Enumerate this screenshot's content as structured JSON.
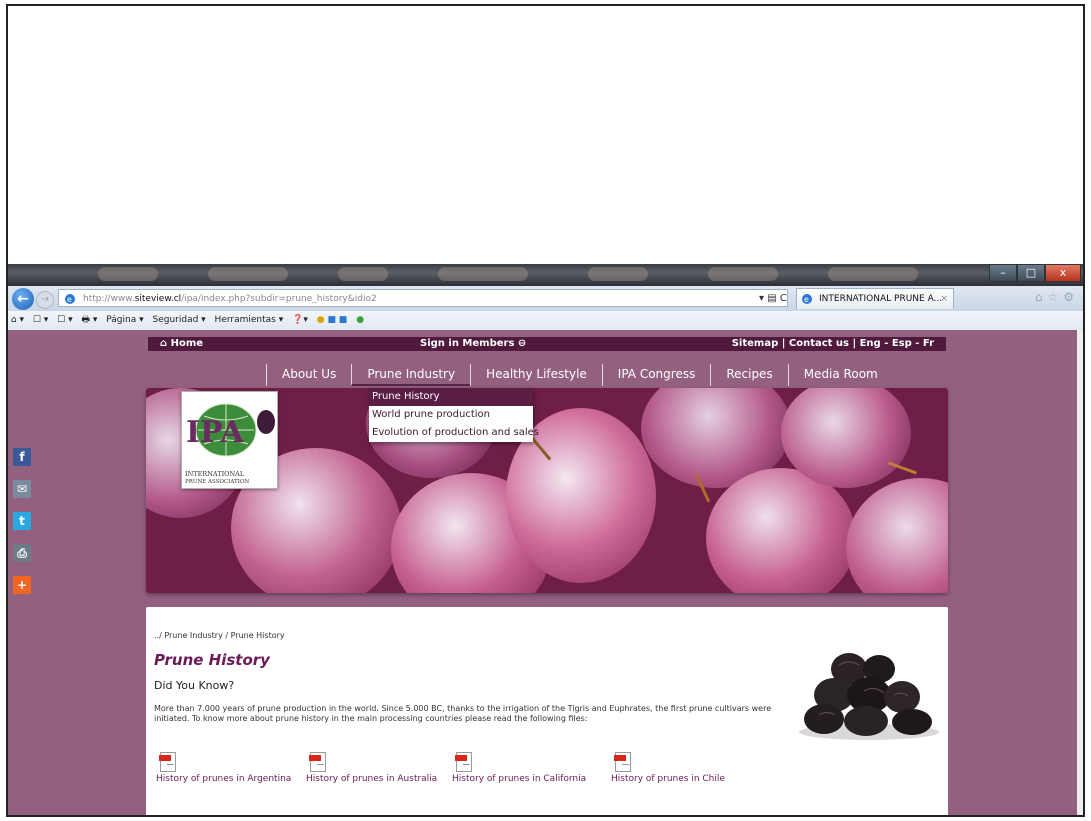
{
  "browser": {
    "url_prefix": "http://www.",
    "url_domain": "siteview.cl",
    "url_rest": "/ipa/index.php?subdir=prune_history&idio2",
    "url_controls": "▾ ▤ C",
    "tab_title": "INTERNATIONAL PRUNE A...",
    "tab_close": "×",
    "window_controls": {
      "minimize": "–",
      "maximize": "□",
      "close": "x"
    },
    "right_icons": "⌂☆⚙",
    "command_bar": [
      "⌂ ▾",
      "☐ ▾",
      "☐ ▾",
      "🖶 ▾",
      "Página ▾",
      "Seguridad ▾",
      "Herramientas ▾",
      "❓▾"
    ]
  },
  "top_nav": {
    "home": "⌂ Home",
    "sign_in": "Sign in Members ⊖",
    "right_links": "Sitemap  |  Contact us  |  Eng  - Esp  - Fr"
  },
  "main_nav": [
    "About Us",
    "Prune Industry",
    "Healthy Lifestyle",
    "IPA Congress",
    "Recipes",
    "Media Room"
  ],
  "dropdown": [
    "Prune History",
    "World prune production",
    "Evolution of production and sales"
  ],
  "logo": {
    "text": "IPA",
    "caption1": "INTERNATIONAL",
    "caption2": "PRUNE ASSOCIATION"
  },
  "share": [
    "f",
    "✉",
    "t",
    "⎙",
    "+"
  ],
  "content": {
    "breadcrumb": "../ Prune Industry / Prune History",
    "title": "Prune History",
    "subtitle": "Did You Know?",
    "paragraph": "More than 7.000 years of prune production in the world. Since 5.000 BC, thanks to the irrigation of the Tigris and Euphrates, the first prune cultivars were initiated. To know more about prune history in the main processing countries please read the following files:",
    "pdf_links": [
      "History of prunes in Argentina",
      "History of prunes in Australia",
      "History of prunes in California",
      "History of prunes in Chile"
    ]
  },
  "colors": {
    "page_bg": "#94607f",
    "nav_dark": "#4f1a3c",
    "title": "#6a1b57"
  }
}
